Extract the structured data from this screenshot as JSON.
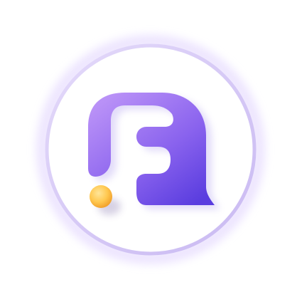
{
  "app_icon": {
    "name": "app-logo",
    "colors": {
      "background": "#ffffff",
      "ring": "#d8ccf6",
      "ring_glow": "#e9e1ff",
      "glyph_top": "#b48cf6",
      "glyph_bottom": "#5b3fe0",
      "dot_light": "#ffd978",
      "dot_dark": "#f5a623"
    }
  }
}
